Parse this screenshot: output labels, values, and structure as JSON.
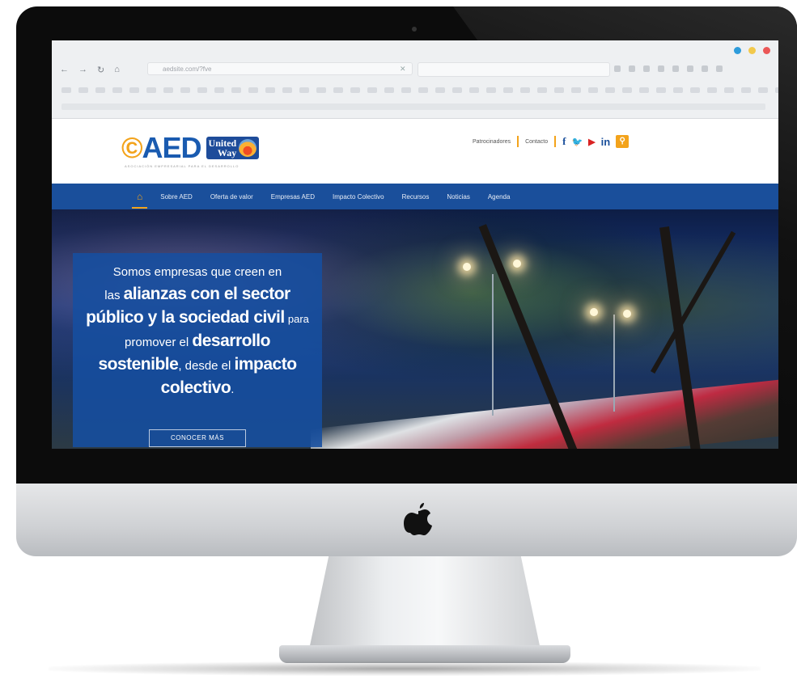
{
  "browser": {
    "address": "aedsite.com/?fve",
    "traffic_colors": [
      "#2d9cdb",
      "#f2c94c",
      "#eb5757"
    ]
  },
  "site": {
    "logo_text": "AED",
    "logo_partner_line1": "United",
    "logo_partner_line2": "Way",
    "logo_subtitle": "ASOCIACIÓN EMPRESARIAL PARA EL DESARROLLO",
    "top_links": [
      "Patrocinadores",
      "Contacto"
    ],
    "social": [
      "f",
      "t",
      "yt",
      "in"
    ],
    "nav": [
      "Sobre AED",
      "Oferta de valor",
      "Empresas AED",
      "Impacto Colectivo",
      "Recursos",
      "Noticias",
      "Agenda"
    ],
    "accent": "#f3a31b",
    "brand_blue": "#1a4f9b"
  },
  "hero": {
    "line1": "Somos empresas que creen en",
    "line2_small": "las",
    "line2_bold": "alianzas con el sector",
    "line3_bold": "público y la sociedad civil",
    "line3_small": "para",
    "line4_small": "promover el",
    "line4_bold": "desarrollo",
    "line5_bold1": "sostenible",
    "line5_small": ", desde el",
    "line5_bold2": "impacto",
    "line6_bold": "colectivo",
    "line6_small": ".",
    "cta": "CONOCER MÁS"
  }
}
